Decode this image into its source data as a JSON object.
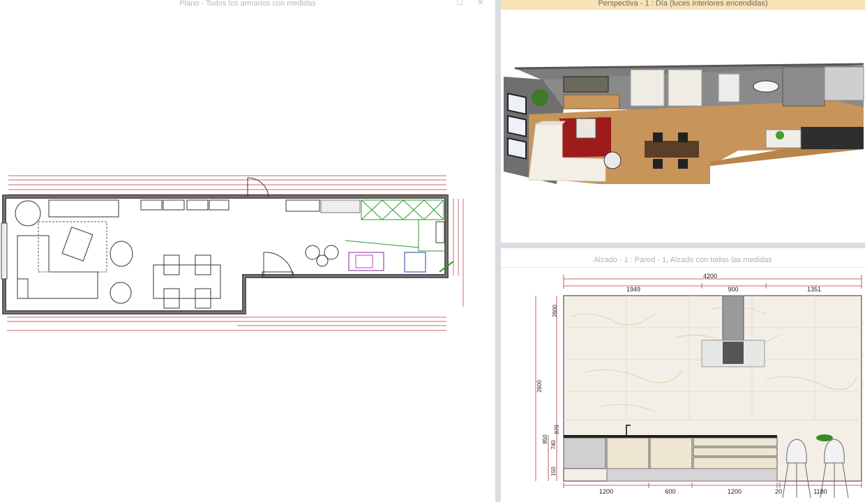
{
  "plan": {
    "title": "Plano - Todos los armarios con medidas",
    "maximize_glyph": "☐",
    "close_glyph": "✕"
  },
  "perspective": {
    "title": "Perspectiva - 1 : Día (luces interiores encendidas)"
  },
  "elevation": {
    "title": "Alzado - 1 : Pared - 1, Alzado con todas las medidas",
    "dims_top": {
      "total": "4200",
      "a": "1949",
      "b": "900",
      "c": "1351"
    },
    "dims_left": {
      "h1": "2600",
      "h2": "2600",
      "h3": "850",
      "h4": "740",
      "h5": "870",
      "h6": "150"
    },
    "dims_bottom": [
      "1200",
      "600",
      "1200",
      "20",
      "1180"
    ]
  }
}
